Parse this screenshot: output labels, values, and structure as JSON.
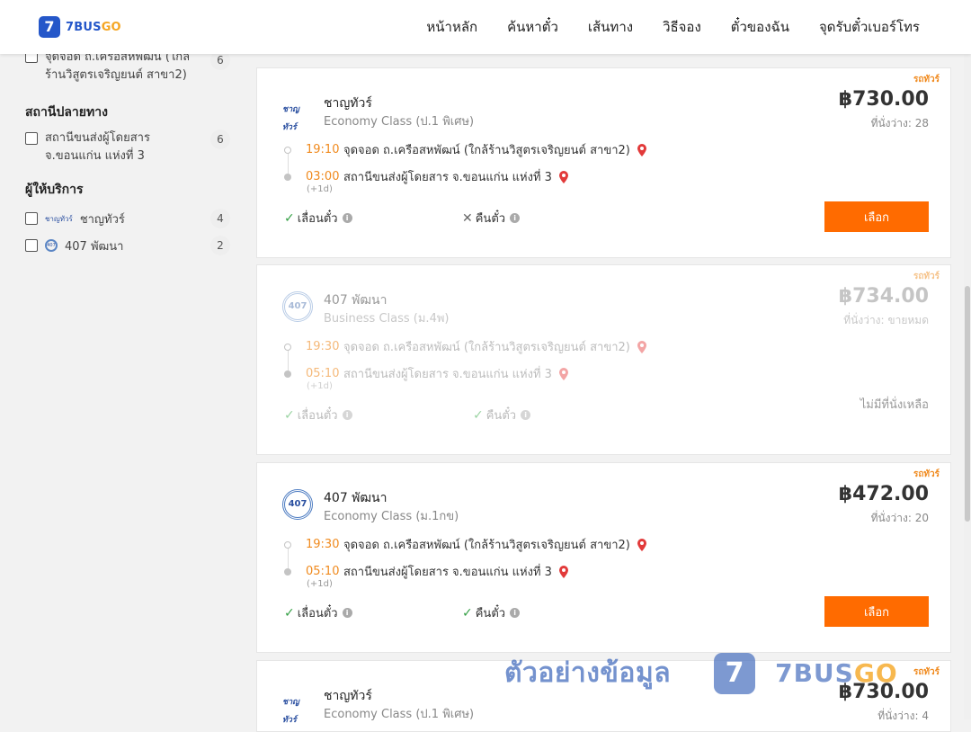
{
  "brand": {
    "icon": "7",
    "name_main": "7BUS",
    "name_go": "GO"
  },
  "nav": [
    "หน้าหลัก",
    "ค้นหาตั๋ว",
    "เส้นทาง",
    "วิธีจอง",
    "ตั๋วของฉัน",
    "จุดรับตั๋วเบอร์โทร"
  ],
  "sidebar": {
    "partial_item": {
      "label_line1": "จุดจอด ถ.เครือสหพัฒน์ (ใกล้",
      "label_line2": "ร้านวิสูตรเจริญยนต์ สาขา2)",
      "count": "6"
    },
    "destination": {
      "title": "สถานีปลายทาง",
      "item": {
        "label_line1": "สถานีขนส่งผู้โดยสาร",
        "label_line2": "จ.ขอนแก่น แห่งที่ 3",
        "count": "6"
      }
    },
    "providers": {
      "title": "ผู้ให้บริการ",
      "items": [
        {
          "label": "ชาญทัวร์",
          "count": "4",
          "icon": "chantour-logo"
        },
        {
          "label": "407 พัฒนา",
          "count": "2",
          "icon": "407-logo"
        }
      ]
    }
  },
  "trips": [
    {
      "tag": "รถทัวร์",
      "operator": "ชาญทัวร์",
      "operator_logo": "ชาญทัวร์",
      "class": "Economy Class (ป.1 พิเศษ)",
      "price": "฿730.00",
      "seats": "ที่นั่งว่าง: 28",
      "dep_time": "19:10",
      "dep_stop": "จุดจอด ถ.เครือสหพัฒน์ (ใกล้ร้านวิสูตรเจริญยนต์ สาขา2)",
      "arr_time": "03:00",
      "arr_stop": "สถานีขนส่งผู้โดยสาร จ.ขอนแก่น แห่งที่ 3",
      "plus": "(+1d)",
      "policy1": "เลื่อนตั๋ว",
      "policy2": "คืนตั๋ว",
      "button": "เลือก"
    },
    {
      "tag": "รถทัวร์",
      "operator": "407 พัฒนา",
      "operator_logo": "407",
      "class": "Business Class (ม.4พ)",
      "price": "฿734.00",
      "seats": "ที่นั่งว่าง: ขายหมด",
      "dep_time": "19:30",
      "dep_stop": "จุดจอด ถ.เครือสหพัฒน์ (ใกล้ร้านวิสูตรเจริญยนต์ สาขา2)",
      "arr_time": "05:10",
      "arr_stop": "สถานีขนส่งผู้โดยสาร จ.ขอนแก่น แห่งที่ 3",
      "plus": "(+1d)",
      "policy1": "เลื่อนตั๋ว",
      "policy2": "คืนตั๋ว",
      "soldout_note": "ไม่มีที่นั่งเหลือ"
    },
    {
      "tag": "รถทัวร์",
      "operator": "407 พัฒนา",
      "operator_logo": "407",
      "class": "Economy Class (ม.1กข)",
      "price": "฿472.00",
      "seats": "ที่นั่งว่าง: 20",
      "dep_time": "19:30",
      "dep_stop": "จุดจอด ถ.เครือสหพัฒน์ (ใกล้ร้านวิสูตรเจริญยนต์ สาขา2)",
      "arr_time": "05:10",
      "arr_stop": "สถานีขนส่งผู้โดยสาร จ.ขอนแก่น แห่งที่ 3",
      "plus": "(+1d)",
      "policy1": "เลื่อนตั๋ว",
      "policy2": "คืนตั๋ว",
      "button": "เลือก"
    },
    {
      "tag": "รถทัวร์",
      "operator": "ชาญทัวร์",
      "operator_logo": "ชาญทัวร์",
      "class": "Economy Class (ป.1 พิเศษ)",
      "price": "฿730.00",
      "seats": "ที่นั่งว่าง: 4"
    }
  ],
  "watermark": {
    "text": "ตัวอย่างข้อมูล",
    "icon": "7",
    "brand_main": "7BUS",
    "brand_go": "GO"
  }
}
